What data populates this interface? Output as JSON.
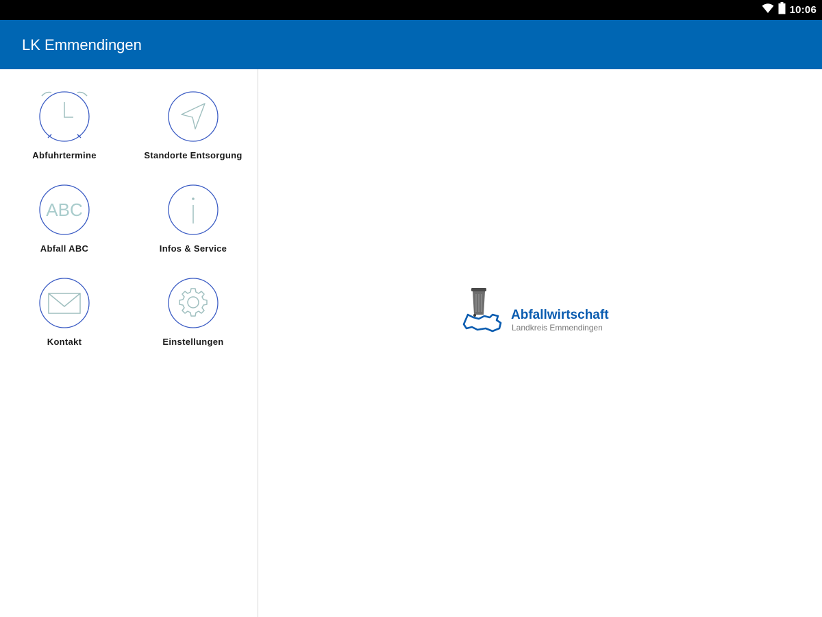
{
  "status": {
    "time": "10:06",
    "wifi_icon": "wifi-icon",
    "battery_icon": "battery-icon"
  },
  "appbar": {
    "title": "LK Emmendingen",
    "color": "#0066b3"
  },
  "menu": {
    "items": [
      {
        "label": "Abfuhrtermine",
        "icon": "alarm-clock-icon"
      },
      {
        "label": "Standorte Entsorgung",
        "icon": "navigation-arrow-icon"
      },
      {
        "label": "Abfall ABC",
        "icon": "abc-icon",
        "icon_text": "ABC"
      },
      {
        "label": "Infos & Service",
        "icon": "info-icon"
      },
      {
        "label": "Kontakt",
        "icon": "mail-icon"
      },
      {
        "label": "Einstellungen",
        "icon": "gear-icon"
      }
    ],
    "ring_color": "#3b5cc4",
    "icon_line_color": "#9fbfbf"
  },
  "logo": {
    "title": "Abfallwirtschaft",
    "subtitle": "Landkreis Emmendingen",
    "title_color": "#0a5cb0"
  }
}
